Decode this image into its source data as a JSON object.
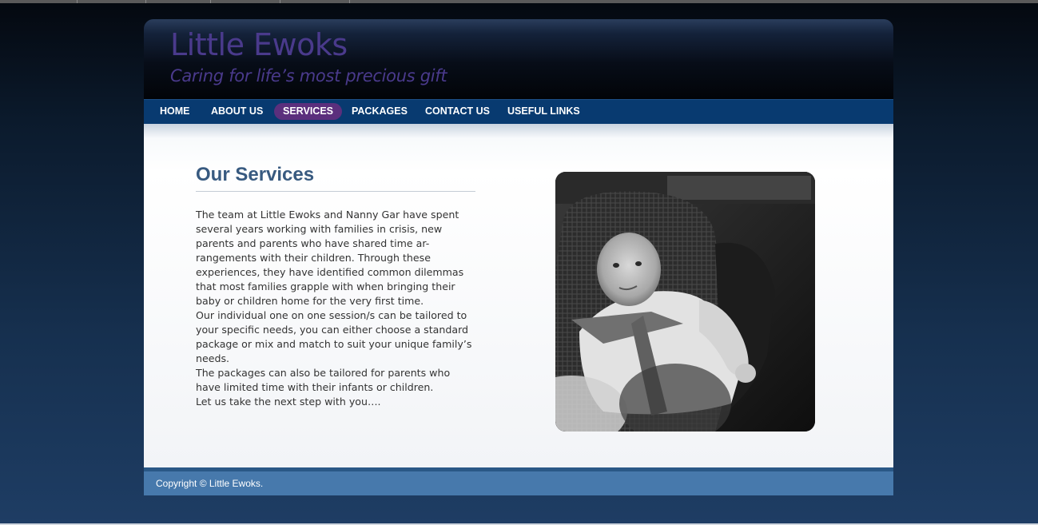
{
  "header": {
    "site_title": "Little Ewoks",
    "tagline": "Caring for life’s most precious gift"
  },
  "nav": {
    "items": [
      {
        "label": "HOME"
      },
      {
        "label": "ABOUT US"
      },
      {
        "label": "SERVICES",
        "active": true
      },
      {
        "label": "PACKAGES"
      },
      {
        "label": "CONTACT US"
      },
      {
        "label": "USEFUL LINKS"
      }
    ]
  },
  "main": {
    "title": "Our Services",
    "paragraphs": [
      "The team at Little Ewoks and Nanny Gar have spent several years working with families in crisis, new parents and parents who have shared time ar-rangements with their children. Through these experiences, they have identified common dilemmas that most families grapple with when bringing their baby or children home for the very first time.",
      "Our individual one on one session/s can be tailored to your specific needs, you can either choose a standard package or mix and match to suit your unique family’s needs.",
      "The packages can also be tailored for parents who have limited time with their infants or children.",
      "Let us take the next step with you…."
    ]
  },
  "footer": {
    "copyright": "Copyright © Little Ewoks."
  },
  "colors": {
    "title_purple": "#4a3a8c",
    "nav_blue": "#083a70",
    "nav_active": "#5b2f7d",
    "heading_blue": "#385a80",
    "footer_blue": "#4779ac"
  }
}
